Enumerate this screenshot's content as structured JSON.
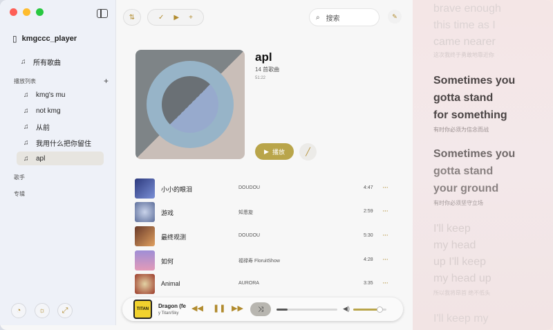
{
  "sidebar": {
    "app_title": "kmgccc_player",
    "all_songs": "所有歌曲",
    "playlists_label": "播放列表",
    "add_symbol": "+",
    "playlists": [
      {
        "label": "kmg's mu"
      },
      {
        "label": "not kmg"
      },
      {
        "label": "从前"
      },
      {
        "label": "我用什么把你留住"
      },
      {
        "label": "apl"
      }
    ],
    "artists_label": "歌手",
    "albums_label": "专辑",
    "bottom_icons": [
      "logo-icon",
      "sun-icon",
      "expand-icon"
    ]
  },
  "toolbar": {
    "search_placeholder": "搜索"
  },
  "album": {
    "title": "apl",
    "count": "14 首歌曲",
    "duration": "51:22",
    "play_label": "播放"
  },
  "tracks": [
    {
      "title": "小小的眼泪",
      "artist": "DOUDOU",
      "duration": "4:47",
      "more": "···"
    },
    {
      "title": "游戏",
      "artist": "知恩旋",
      "duration": "2:59",
      "more": "···"
    },
    {
      "title": "最终观测",
      "artist": "DOUDOU",
      "duration": "5:30",
      "more": "···"
    },
    {
      "title": "如何",
      "artist": "福禄寿 FloruitShow",
      "duration": "4:28",
      "more": "···"
    },
    {
      "title": "Animal",
      "artist": "AURORA",
      "duration": "3:35",
      "more": "···"
    }
  ],
  "player": {
    "title": "Dragon (fe",
    "artist": "y Titan/Sky",
    "art_text": "TITAN",
    "progress": 0.18,
    "volume": 0.82
  },
  "lyrics": {
    "l1": "brave enough",
    "l2": "this time as I",
    "l3": "came nearer",
    "l3_sub": "这次我终于勇敢地靠近你",
    "a1": "Sometimes you",
    "a2": "gotta stand",
    "a3": "for something",
    "a_sub": "有时你必须为信念而战",
    "b1": "Sometimes you",
    "b2": "gotta stand",
    "b3": "your ground",
    "b_sub": "有时你必须坚守立场",
    "c1": "I'll keep",
    "c2": "my head",
    "c3": "up I'll keep",
    "c4": "my head up",
    "c_sub": "所以我将昂首 绝不低头",
    "d1": "I'll keep my"
  },
  "colors": {
    "accent": "#b9a54a",
    "icon_gold": "#b18b2e"
  }
}
